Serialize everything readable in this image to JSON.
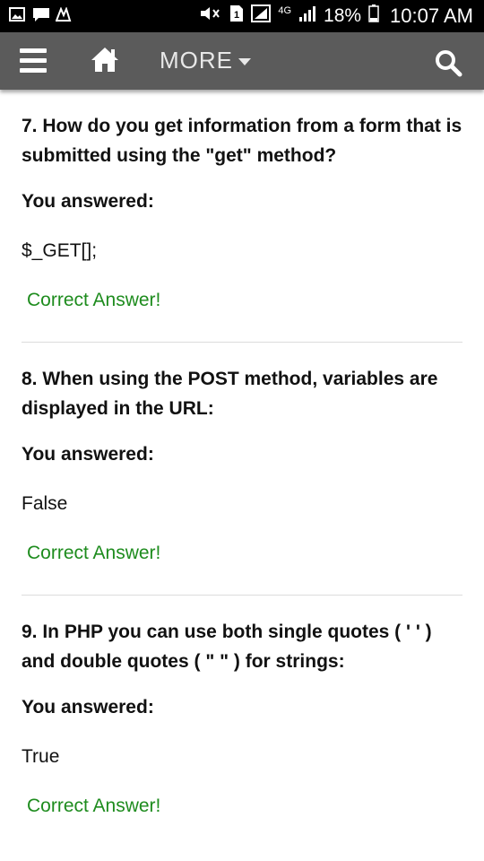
{
  "status_bar": {
    "battery_percent": "18%",
    "time": "10:07 AM",
    "network": "4G",
    "left_icons": [
      "image-icon",
      "chat-icon",
      "app-icon"
    ],
    "right_icons": [
      "mute-icon",
      "sim-icon",
      "signal-icon",
      "network-4g-icon",
      "signal-bars-icon",
      "battery-icon"
    ]
  },
  "navbar": {
    "more_label": "MORE",
    "icons": [
      "menu-icon",
      "home-icon",
      "caret-down-icon",
      "search-icon"
    ]
  },
  "questions": [
    {
      "title": "7. How do you get information from a form that is submitted using the \"get\" method?",
      "answered_label": "You answered:",
      "answer": "$_GET[];",
      "result": "Correct Answer!"
    },
    {
      "title": "8. When using the POST method, variables are displayed in the URL:",
      "answered_label": "You answered:",
      "answer": "False",
      "result": "Correct Answer!"
    },
    {
      "title": "9. In PHP you can use both single quotes ( ' ' ) and double quotes ( \" \" ) for strings:",
      "answered_label": "You answered:",
      "answer": "True",
      "result": "Correct Answer!"
    }
  ],
  "colors": {
    "navbar": "#5b5b5b",
    "correct": "#1e8c1e",
    "status_bar": "#000000"
  }
}
